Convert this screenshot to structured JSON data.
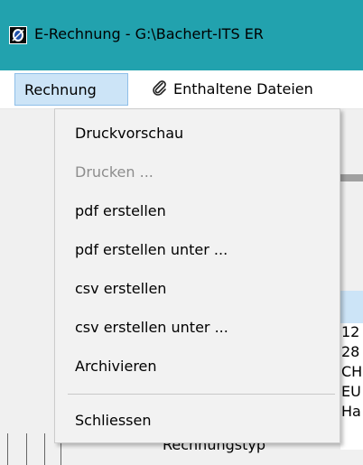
{
  "window": {
    "title": "E-Rechnung - G:\\Bachert-ITS ER",
    "icon": "app-logo-icon"
  },
  "menubar": {
    "rechnung": "Rechnung",
    "files": "Enthaltene Dateien",
    "files_icon": "paperclip-icon"
  },
  "dropdown": {
    "items": [
      {
        "label": "Druckvorschau",
        "enabled": true
      },
      {
        "label": "Drucken ...",
        "enabled": false
      },
      {
        "label": "pdf erstellen",
        "enabled": true
      },
      {
        "label": "pdf erstellen unter ...",
        "enabled": true
      },
      {
        "label": "csv erstellen",
        "enabled": true
      },
      {
        "label": "csv erstellen unter ...",
        "enabled": true
      },
      {
        "label": "Archivieren",
        "enabled": true
      },
      {
        "label": "Schliessen",
        "enabled": true
      }
    ]
  },
  "background": {
    "right_values": [
      "12",
      "28",
      "CH",
      "EU",
      "Ha"
    ],
    "bottom_label": "Rechnungstyp"
  },
  "colors": {
    "titlebar": "#22a2ae",
    "menu_highlight": "#cce4f7",
    "disabled_text": "#8d8d8d"
  }
}
